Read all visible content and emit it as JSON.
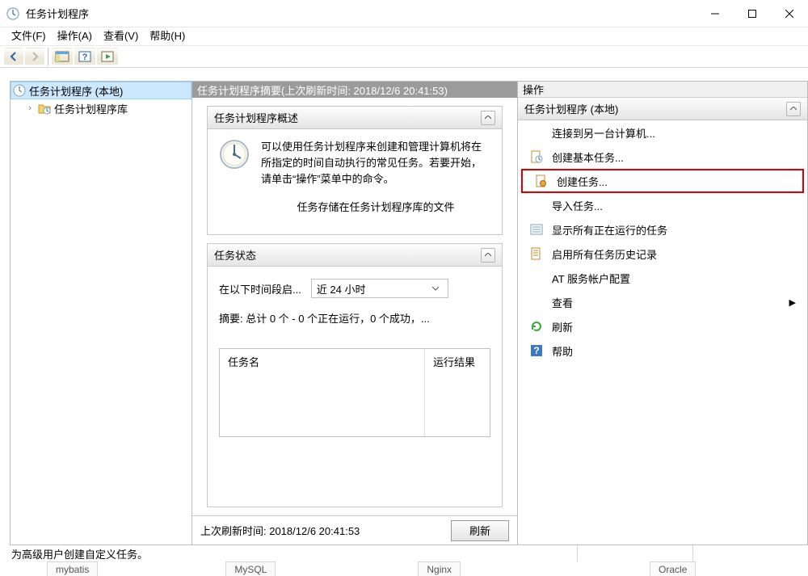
{
  "title": "任务计划程序",
  "menubar": [
    {
      "label": "文件(F)"
    },
    {
      "label": "操作(A)"
    },
    {
      "label": "查看(V)"
    },
    {
      "label": "帮助(H)"
    }
  ],
  "tree": {
    "root": "任务计划程序 (本地)",
    "child": "任务计划程序库"
  },
  "center": {
    "header": "任务计划程序摘要(上次刷新时间: 2018/12/6 20:41:53)",
    "overview_title": "任务计划程序概述",
    "overview_text": "可以使用任务计划程序来创建和管理计算机将在所指定的时间自动执行的常见任务。若要开始，请单击“操作”菜单中的命令。",
    "overview_tail": "任务存储在任务计划程序库的文件",
    "status_title": "任务状态",
    "status_label": "在以下时间段启...",
    "status_dropdown": "近 24 小时",
    "summary": "摘要: 总计 0 个 - 0 个正在运行，0 个成功，...",
    "col_name": "任务名",
    "col_result": "运行结果",
    "footer_text": "上次刷新时间: 2018/12/6 20:41:53",
    "refresh_btn": "刷新"
  },
  "actions": {
    "pane_title": "操作",
    "group_title": "任务计划程序 (本地)",
    "items": [
      {
        "icon": "none",
        "label": "连接到另一台计算机..."
      },
      {
        "icon": "doc-clock",
        "label": "创建基本任务..."
      },
      {
        "icon": "doc-gear",
        "label": "创建任务...",
        "highlight": true
      },
      {
        "icon": "none",
        "label": "导入任务..."
      },
      {
        "icon": "list",
        "label": "显示所有正在运行的任务"
      },
      {
        "icon": "doc-enable",
        "label": "启用所有任务历史记录"
      },
      {
        "icon": "none",
        "label": "AT 服务帐户配置"
      },
      {
        "icon": "none",
        "label": "查看",
        "arrow": true
      },
      {
        "icon": "refresh",
        "label": "刷新"
      },
      {
        "icon": "help",
        "label": "帮助"
      }
    ]
  },
  "statusbar": "为高级用户创建自定义任务。",
  "bottom_tabs": [
    "mybatis",
    "MySQL",
    "Nginx",
    "Oracle"
  ]
}
